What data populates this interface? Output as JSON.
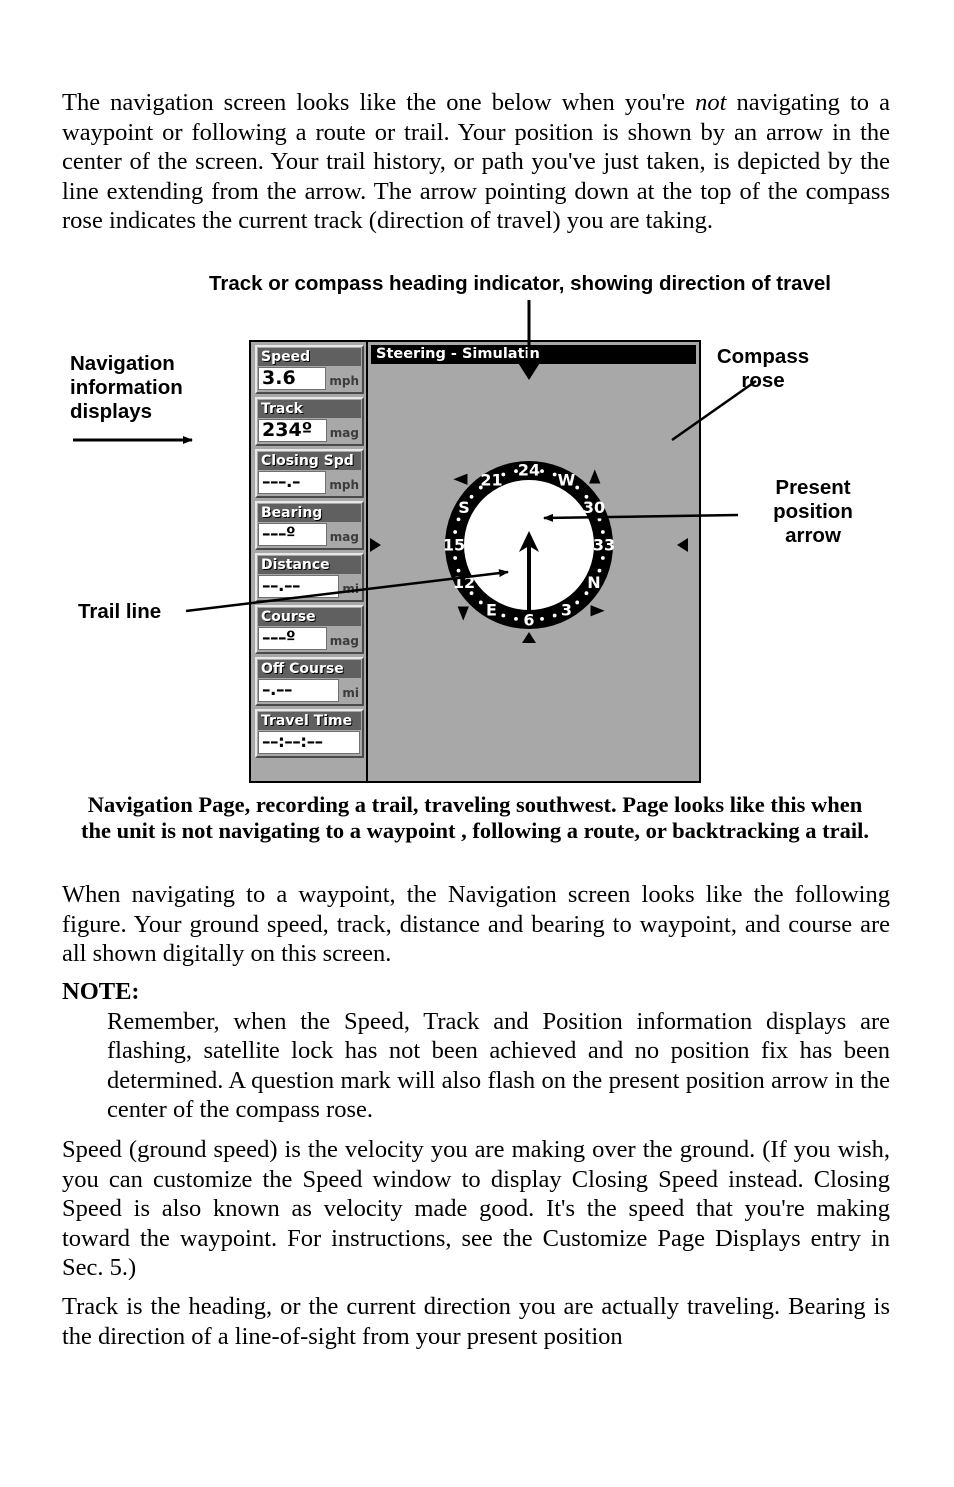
{
  "page": {
    "paragraphs": [
      {
        "id": "p1",
        "runs": [
          {
            "t": "The navigation screen looks like the one below when you're "
          },
          {
            "t": "not",
            "i": true
          },
          {
            "t": " navigating to a waypoint or following a route or trail. Your position is shown by an arrow in the center of the screen. Your trail history, or path you've just taken, is depicted by the line extending from the arrow. The arrow pointing down at the top of the compass rose indicates the current track (direction of travel) you are taking."
          }
        ]
      }
    ],
    "para_when_navigating": "When navigating to a waypoint, the Navigation screen looks like the following figure. Your ground speed, track, distance and bearing to waypoint, and course are all shown digitally on this screen.",
    "note_heading": "NOTE:",
    "note_text": "Remember, when the Speed, Track and Position information displays are flashing, satellite lock has not been achieved and no position fix has been determined. A question mark will also flash on the present position arrow in the center of the compass rose.",
    "para_speed": "Speed (ground speed) is the velocity you are making over the ground. (If you wish, you can customize the Speed window to display Closing Speed instead. Closing Speed is also known as velocity made good. It's the speed that you're making toward the waypoint. For instructions, see the Customize Page Displays entry in Sec. 5.)",
    "para_track": "Track is the heading, or the current direction you are actually traveling. Bearing is the direction of a line-of-sight from your present position"
  },
  "figure": {
    "caption": "Navigation Page, recording a trail, traveling southwest. Page looks like this when the unit is not navigating to a waypoint , following a route, or backtracking a trail.",
    "annotations": {
      "top": "Track or compass heading indicator, showing direction of travel",
      "left_displays": "Navigation\ninformation\ndisplays",
      "left_displays_l1": "Navigation",
      "left_displays_l2": "information",
      "left_displays_l3": "displays",
      "trail_line": "Trail line",
      "compass_rose_l1": "Compass",
      "compass_rose_l2": "rose",
      "present_pos_l1": "Present",
      "present_pos_l2": "position",
      "present_pos_l3": "arrow"
    }
  },
  "device": {
    "title": "Steering - Simulatin",
    "info_displays": [
      {
        "label": "Speed",
        "value": "3.6",
        "unit": "mph"
      },
      {
        "label": "Track",
        "value": "234º",
        "unit": "mag"
      },
      {
        "label": "Closing Spd",
        "value": "–––.–",
        "unit": "mph"
      },
      {
        "label": "Bearing",
        "value": "–––º",
        "unit": "mag"
      },
      {
        "label": "Distance",
        "value": "––.––",
        "unit": "mi"
      },
      {
        "label": "Course",
        "value": "–––º",
        "unit": "mag"
      },
      {
        "label": "Off Course",
        "value": "–.––",
        "unit": "mi"
      },
      {
        "label": "Travel Time",
        "value": "––:––:––",
        "unit": ""
      }
    ],
    "compass": {
      "heading_deg": 234,
      "ring_labels": [
        "24",
        "W",
        "30",
        "33",
        "N",
        "3",
        "6",
        "E",
        "12",
        "15",
        "S",
        "21"
      ],
      "ring_label_angles_deg": [
        0,
        30,
        60,
        90,
        120,
        150,
        180,
        210,
        240,
        270,
        300,
        330
      ],
      "colors": {
        "screen_bg": "#a8a8a8",
        "ring": "#000000",
        "ring_text": "#ffffff",
        "face": "#ffffff",
        "title_bg": "#000000",
        "label_bg": "#606060",
        "value_bg": "#ffffff"
      }
    }
  }
}
